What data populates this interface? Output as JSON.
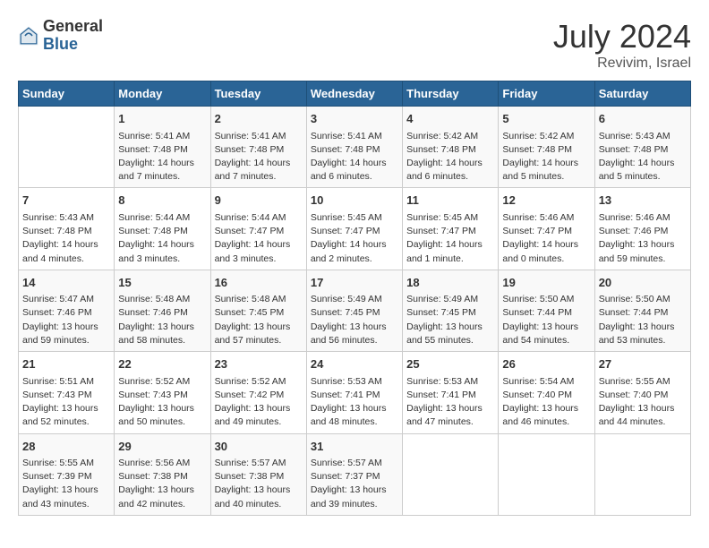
{
  "header": {
    "logo_general": "General",
    "logo_blue": "Blue",
    "month_year": "July 2024",
    "location": "Revivim, Israel"
  },
  "days_of_week": [
    "Sunday",
    "Monday",
    "Tuesday",
    "Wednesday",
    "Thursday",
    "Friday",
    "Saturday"
  ],
  "weeks": [
    [
      {
        "day": "",
        "sunrise": "",
        "sunset": "",
        "daylight": ""
      },
      {
        "day": "1",
        "sunrise": "Sunrise: 5:41 AM",
        "sunset": "Sunset: 7:48 PM",
        "daylight": "Daylight: 14 hours and 7 minutes."
      },
      {
        "day": "2",
        "sunrise": "Sunrise: 5:41 AM",
        "sunset": "Sunset: 7:48 PM",
        "daylight": "Daylight: 14 hours and 7 minutes."
      },
      {
        "day": "3",
        "sunrise": "Sunrise: 5:41 AM",
        "sunset": "Sunset: 7:48 PM",
        "daylight": "Daylight: 14 hours and 6 minutes."
      },
      {
        "day": "4",
        "sunrise": "Sunrise: 5:42 AM",
        "sunset": "Sunset: 7:48 PM",
        "daylight": "Daylight: 14 hours and 6 minutes."
      },
      {
        "day": "5",
        "sunrise": "Sunrise: 5:42 AM",
        "sunset": "Sunset: 7:48 PM",
        "daylight": "Daylight: 14 hours and 5 minutes."
      },
      {
        "day": "6",
        "sunrise": "Sunrise: 5:43 AM",
        "sunset": "Sunset: 7:48 PM",
        "daylight": "Daylight: 14 hours and 5 minutes."
      }
    ],
    [
      {
        "day": "7",
        "sunrise": "Sunrise: 5:43 AM",
        "sunset": "Sunset: 7:48 PM",
        "daylight": "Daylight: 14 hours and 4 minutes."
      },
      {
        "day": "8",
        "sunrise": "Sunrise: 5:44 AM",
        "sunset": "Sunset: 7:48 PM",
        "daylight": "Daylight: 14 hours and 3 minutes."
      },
      {
        "day": "9",
        "sunrise": "Sunrise: 5:44 AM",
        "sunset": "Sunset: 7:47 PM",
        "daylight": "Daylight: 14 hours and 3 minutes."
      },
      {
        "day": "10",
        "sunrise": "Sunrise: 5:45 AM",
        "sunset": "Sunset: 7:47 PM",
        "daylight": "Daylight: 14 hours and 2 minutes."
      },
      {
        "day": "11",
        "sunrise": "Sunrise: 5:45 AM",
        "sunset": "Sunset: 7:47 PM",
        "daylight": "Daylight: 14 hours and 1 minute."
      },
      {
        "day": "12",
        "sunrise": "Sunrise: 5:46 AM",
        "sunset": "Sunset: 7:47 PM",
        "daylight": "Daylight: 14 hours and 0 minutes."
      },
      {
        "day": "13",
        "sunrise": "Sunrise: 5:46 AM",
        "sunset": "Sunset: 7:46 PM",
        "daylight": "Daylight: 13 hours and 59 minutes."
      }
    ],
    [
      {
        "day": "14",
        "sunrise": "Sunrise: 5:47 AM",
        "sunset": "Sunset: 7:46 PM",
        "daylight": "Daylight: 13 hours and 59 minutes."
      },
      {
        "day": "15",
        "sunrise": "Sunrise: 5:48 AM",
        "sunset": "Sunset: 7:46 PM",
        "daylight": "Daylight: 13 hours and 58 minutes."
      },
      {
        "day": "16",
        "sunrise": "Sunrise: 5:48 AM",
        "sunset": "Sunset: 7:45 PM",
        "daylight": "Daylight: 13 hours and 57 minutes."
      },
      {
        "day": "17",
        "sunrise": "Sunrise: 5:49 AM",
        "sunset": "Sunset: 7:45 PM",
        "daylight": "Daylight: 13 hours and 56 minutes."
      },
      {
        "day": "18",
        "sunrise": "Sunrise: 5:49 AM",
        "sunset": "Sunset: 7:45 PM",
        "daylight": "Daylight: 13 hours and 55 minutes."
      },
      {
        "day": "19",
        "sunrise": "Sunrise: 5:50 AM",
        "sunset": "Sunset: 7:44 PM",
        "daylight": "Daylight: 13 hours and 54 minutes."
      },
      {
        "day": "20",
        "sunrise": "Sunrise: 5:50 AM",
        "sunset": "Sunset: 7:44 PM",
        "daylight": "Daylight: 13 hours and 53 minutes."
      }
    ],
    [
      {
        "day": "21",
        "sunrise": "Sunrise: 5:51 AM",
        "sunset": "Sunset: 7:43 PM",
        "daylight": "Daylight: 13 hours and 52 minutes."
      },
      {
        "day": "22",
        "sunrise": "Sunrise: 5:52 AM",
        "sunset": "Sunset: 7:43 PM",
        "daylight": "Daylight: 13 hours and 50 minutes."
      },
      {
        "day": "23",
        "sunrise": "Sunrise: 5:52 AM",
        "sunset": "Sunset: 7:42 PM",
        "daylight": "Daylight: 13 hours and 49 minutes."
      },
      {
        "day": "24",
        "sunrise": "Sunrise: 5:53 AM",
        "sunset": "Sunset: 7:41 PM",
        "daylight": "Daylight: 13 hours and 48 minutes."
      },
      {
        "day": "25",
        "sunrise": "Sunrise: 5:53 AM",
        "sunset": "Sunset: 7:41 PM",
        "daylight": "Daylight: 13 hours and 47 minutes."
      },
      {
        "day": "26",
        "sunrise": "Sunrise: 5:54 AM",
        "sunset": "Sunset: 7:40 PM",
        "daylight": "Daylight: 13 hours and 46 minutes."
      },
      {
        "day": "27",
        "sunrise": "Sunrise: 5:55 AM",
        "sunset": "Sunset: 7:40 PM",
        "daylight": "Daylight: 13 hours and 44 minutes."
      }
    ],
    [
      {
        "day": "28",
        "sunrise": "Sunrise: 5:55 AM",
        "sunset": "Sunset: 7:39 PM",
        "daylight": "Daylight: 13 hours and 43 minutes."
      },
      {
        "day": "29",
        "sunrise": "Sunrise: 5:56 AM",
        "sunset": "Sunset: 7:38 PM",
        "daylight": "Daylight: 13 hours and 42 minutes."
      },
      {
        "day": "30",
        "sunrise": "Sunrise: 5:57 AM",
        "sunset": "Sunset: 7:38 PM",
        "daylight": "Daylight: 13 hours and 40 minutes."
      },
      {
        "day": "31",
        "sunrise": "Sunrise: 5:57 AM",
        "sunset": "Sunset: 7:37 PM",
        "daylight": "Daylight: 13 hours and 39 minutes."
      },
      {
        "day": "",
        "sunrise": "",
        "sunset": "",
        "daylight": ""
      },
      {
        "day": "",
        "sunrise": "",
        "sunset": "",
        "daylight": ""
      },
      {
        "day": "",
        "sunrise": "",
        "sunset": "",
        "daylight": ""
      }
    ]
  ]
}
